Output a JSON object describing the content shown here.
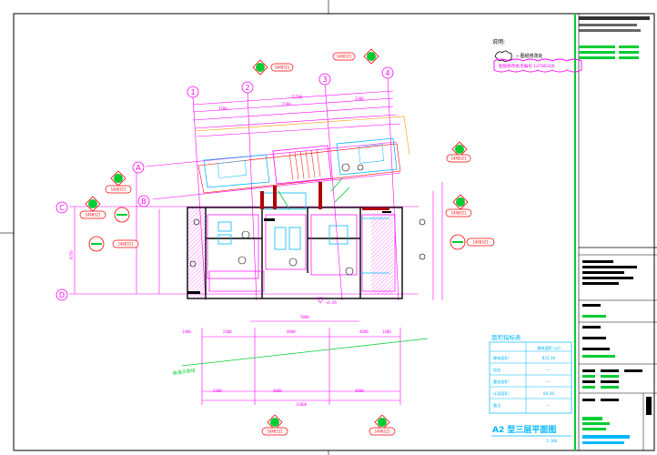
{
  "legend": {
    "title": "说明:",
    "cloud_caption": "─ 图纸修改处",
    "revision_stamp": "图纸修改批次编号 14786326"
  },
  "grid_numbers": [
    "1",
    "2",
    "3",
    "4"
  ],
  "grid_letters": [
    "A",
    "B",
    "C",
    "D"
  ],
  "dimensions": {
    "top_overall": "11700",
    "top_bays": [
      "3700",
      "2700",
      "3300"
    ],
    "left_overall": "6750",
    "bottom_bays": [
      "2300",
      "4000",
      "4000"
    ],
    "bottom_overall": "11000",
    "mid_bottom": "7000"
  },
  "elevation_mark": "+4.85",
  "callout_code": "14X0321",
  "slope_label": "坡道示意线",
  "area_table": {
    "title": "面积指标表",
    "header": "建筑面积 (㎡)",
    "rows": [
      {
        "label": "建筑面积",
        "value": "831.16"
      },
      {
        "label": "阳台",
        "value": "—"
      },
      {
        "label": "露台面积",
        "value": "—"
      },
      {
        "label": "计容面积",
        "value": "84.38"
      },
      {
        "label": "备注",
        "value": "—"
      }
    ]
  },
  "drawing_title": "A2 型三层平面图",
  "drawing_scale": "1:100",
  "colors": {
    "magenta": "#ff00ff",
    "green": "#00cc33",
    "red": "#ff0000",
    "cyan": "#00b7ff",
    "dark_red": "#b00000",
    "frame": "#000000"
  }
}
